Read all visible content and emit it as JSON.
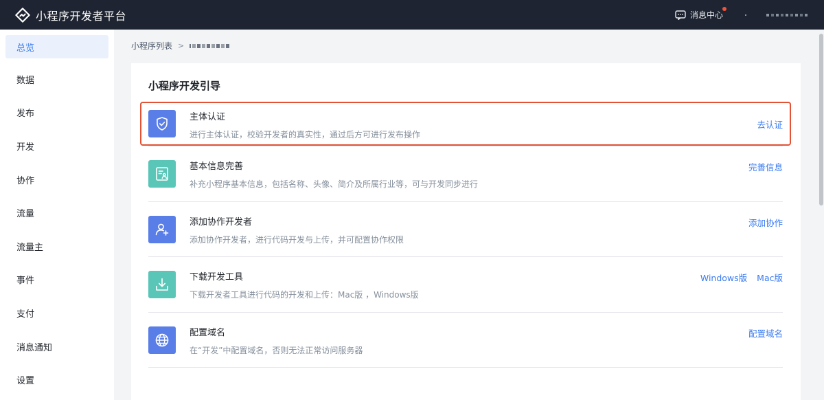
{
  "topbar": {
    "title": "小程序开发者平台",
    "message_center": "消息中心",
    "has_unread": true
  },
  "sidebar": {
    "items": [
      {
        "label": "总览",
        "active": true
      },
      {
        "label": "数据"
      },
      {
        "label": "发布"
      },
      {
        "label": "开发"
      },
      {
        "label": "协作"
      },
      {
        "label": "流量"
      },
      {
        "label": "流量主"
      },
      {
        "label": "事件"
      },
      {
        "label": "支付"
      },
      {
        "label": "消息通知"
      },
      {
        "label": "设置"
      }
    ]
  },
  "breadcrumb": {
    "root": "小程序列表",
    "separator": ">"
  },
  "guide": {
    "title": "小程序开发引导",
    "items": [
      {
        "title": "主体认证",
        "desc": "进行主体认证，校验开发者的真实性，通过后方可进行发布操作",
        "actions": [
          "去认证"
        ],
        "icon": "shield-check-icon",
        "icon_color": "#5a7ee8"
      },
      {
        "title": "基本信息完善",
        "desc": "补充小程序基本信息，包括名称、头像、简介及所属行业等，可与开发同步进行",
        "actions": [
          "完善信息"
        ],
        "icon": "profile-card-icon",
        "icon_color": "#5ac6b8"
      },
      {
        "title": "添加协作开发者",
        "desc": "添加协作开发者，进行代码开发与上传，并可配置协作权限",
        "actions": [
          "添加协作"
        ],
        "icon": "add-user-icon",
        "icon_color": "#5a7ee8"
      },
      {
        "title": "下载开发工具",
        "desc": "下载开发者工具进行代码的开发和上传：Mac版 ，Windows版",
        "actions": [
          "Windows版",
          "Mac版"
        ],
        "icon": "download-icon",
        "icon_color": "#5ac6b8"
      },
      {
        "title": "配置域名",
        "desc": "在“开发”中配置域名，否则无法正常访问服务器",
        "actions": [
          "配置域名"
        ],
        "icon": "globe-icon",
        "icon_color": "#5a7ee8"
      }
    ]
  },
  "colors": {
    "topbar_bg": "#1e2431",
    "accent": "#3a7bf0",
    "highlight_border": "#e25235",
    "unread_dot": "#f0533c"
  }
}
